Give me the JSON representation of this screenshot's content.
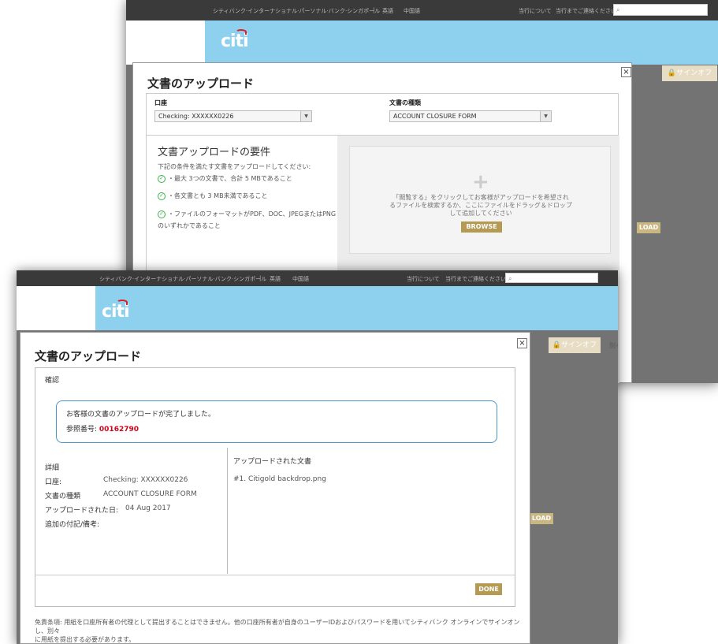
{
  "colors": {
    "brand_blue": "#8ed1ef",
    "gold_button": "#b59a54",
    "success_border": "#4a96c9",
    "reference_red": "#d0021b",
    "check_green": "#3bb34a"
  },
  "top_nav": {
    "bank_name": "シティバンク·インターナショナル·パーソナル·バンク·シンガポール",
    "sep": "|",
    "lang_en": "英語",
    "lang_zh": "中国語",
    "about": "当行について",
    "contact": "当行までご連絡ください",
    "search_icon": "search-icon"
  },
  "logo": {
    "text": "citi"
  },
  "sign_off": {
    "icon": "lock-icon",
    "label": "サインオフ"
  },
  "back_modal": {
    "title": "文書のアップロード",
    "account_label": "口座",
    "account_value": "Checking: XXXXXX0226",
    "doc_type_label": "文書の種類",
    "doc_type_value": "ACCOUNT CLOSURE FORM",
    "requirements_title": "文書アップロードの要件",
    "requirements_intro": "下記の条件を満たす文書をアップロードしてください:",
    "req1": "・最大 3つの文書で、合計 5 MBであること",
    "req2": "・各文書とも 3 MB未満であること",
    "req3": "・ファイルのフォーマットがPDF、DOC、JPEGまたはPNG",
    "req3b": "のいずれかであること",
    "drop_line1": "「閲覧する」をクリックしてお客様がアップロードを希望され",
    "drop_line2": "るファイルを検索するか、ここにファイルをドラッグ＆ドロップ",
    "drop_line3": "して追加してください",
    "browse_label": "BROWSE",
    "bg_button_partial": "LOAD"
  },
  "front_modal": {
    "title": "文書のアップロード",
    "confirm_title": "確認",
    "success_msg": "お客様の文書のアップロードが完了しました。",
    "ref_label": "参照番号: ",
    "ref_number": "00162790",
    "details_title": "詳細",
    "account_label": "口座:",
    "account_value": "Checking: XXXXXX0226",
    "doc_type_label": "文書の種類",
    "doc_type_value": "ACCOUNT CLOSURE FORM",
    "uploaded_date_label": "アップロードされた日:",
    "uploaded_date_value": "04 Aug 2017",
    "notes_label": "追加の付記/備考:",
    "uploaded_docs_title": "アップロードされた文書",
    "uploaded_doc_1": "#1. Citigold backdrop.png",
    "done_label": "DONE",
    "disclaimer_line1": "免責条項: 用紙を口座所有者の代理として提出することはできません。他の口座所有者が自身のユーザーIDおよびパスワードを用いてシティバンク オンラインでサインオンし、別々",
    "disclaimer_line2": "に用紙を提出する必要があります。",
    "bg_button_partial": "LOAD",
    "side_text_partial": "別々"
  }
}
